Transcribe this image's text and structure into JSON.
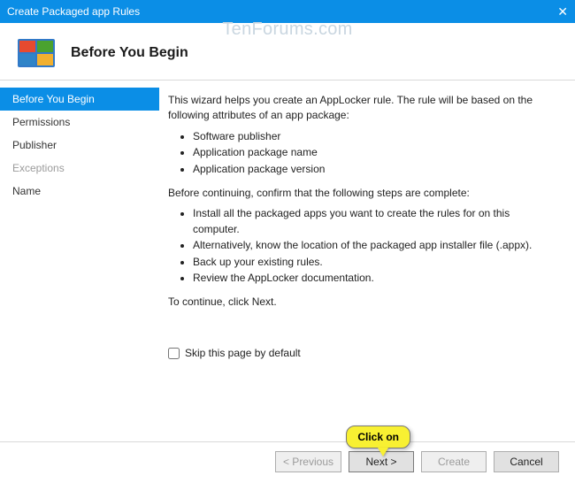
{
  "titlebar": {
    "title": "Create Packaged app Rules"
  },
  "watermark": "TenForums.com",
  "header": {
    "title": "Before You Begin"
  },
  "sidebar": {
    "items": [
      {
        "label": "Before You Begin",
        "state": "selected"
      },
      {
        "label": "Permissions",
        "state": "normal"
      },
      {
        "label": "Publisher",
        "state": "normal"
      },
      {
        "label": "Exceptions",
        "state": "disabled"
      },
      {
        "label": "Name",
        "state": "normal"
      }
    ]
  },
  "content": {
    "intro": "This wizard helps you create an AppLocker rule. The rule will be based on the following attributes of an app package:",
    "attrs": [
      "Software publisher",
      "Application package name",
      "Application package version"
    ],
    "confirm": "Before continuing, confirm that the following steps are complete:",
    "steps": [
      "Install all the packaged apps you want to create the rules for on this computer.",
      "Alternatively, know the location of the packaged app installer file (.appx).",
      "Back up your existing rules.",
      "Review the AppLocker documentation."
    ],
    "continue": "To continue, click Next.",
    "skip_label": "Skip this page by default"
  },
  "footer": {
    "previous": "< Previous",
    "next": "Next >",
    "create": "Create",
    "cancel": "Cancel"
  },
  "callout": {
    "text": "Click on"
  }
}
